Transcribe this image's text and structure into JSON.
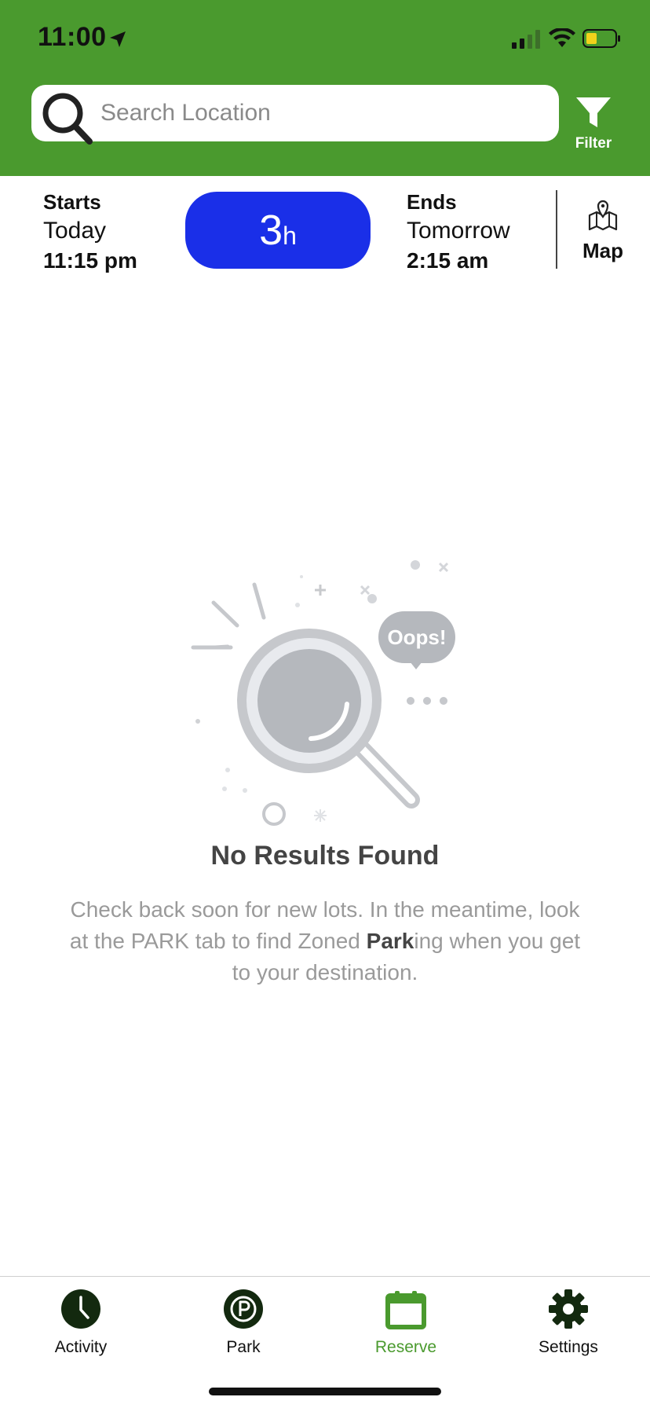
{
  "status_bar": {
    "time": "11:00",
    "icons": [
      "location-arrow-icon",
      "cellular-signal-icon",
      "wifi-icon",
      "battery-icon"
    ]
  },
  "search": {
    "placeholder": "Search Location",
    "value": ""
  },
  "filter": {
    "label": "Filter",
    "icon": "funnel-icon"
  },
  "time_range": {
    "starts_label": "Starts",
    "starts_day": "Today",
    "starts_time": "11:15 pm",
    "duration_value": "3",
    "duration_unit": "h",
    "ends_label": "Ends",
    "ends_day": "Tomorrow",
    "ends_time": "2:15 am"
  },
  "map": {
    "label": "Map",
    "icon": "map-pin-icon"
  },
  "empty_state": {
    "badge": "Oops!",
    "title": "No Results Found",
    "message_line1": "Check back soon for new lots. In the meantime, look at the PARK tab to find Zoned ",
    "message_bold": "Park",
    "message_line2": "ing when you get to your destination."
  },
  "tabs": [
    {
      "label": "Activity",
      "icon": "clock-icon",
      "active": false
    },
    {
      "label": "Park",
      "icon": "parking-icon",
      "active": false
    },
    {
      "label": "Reserve",
      "icon": "calendar-icon",
      "active": true
    },
    {
      "label": "Settings",
      "icon": "gear-icon",
      "active": false
    }
  ],
  "colors": {
    "header_green": "#4a9a2e",
    "duration_blue": "#1a2fe8",
    "active_tab_green": "#4a9a2e",
    "muted_text": "#9a9a9a"
  }
}
